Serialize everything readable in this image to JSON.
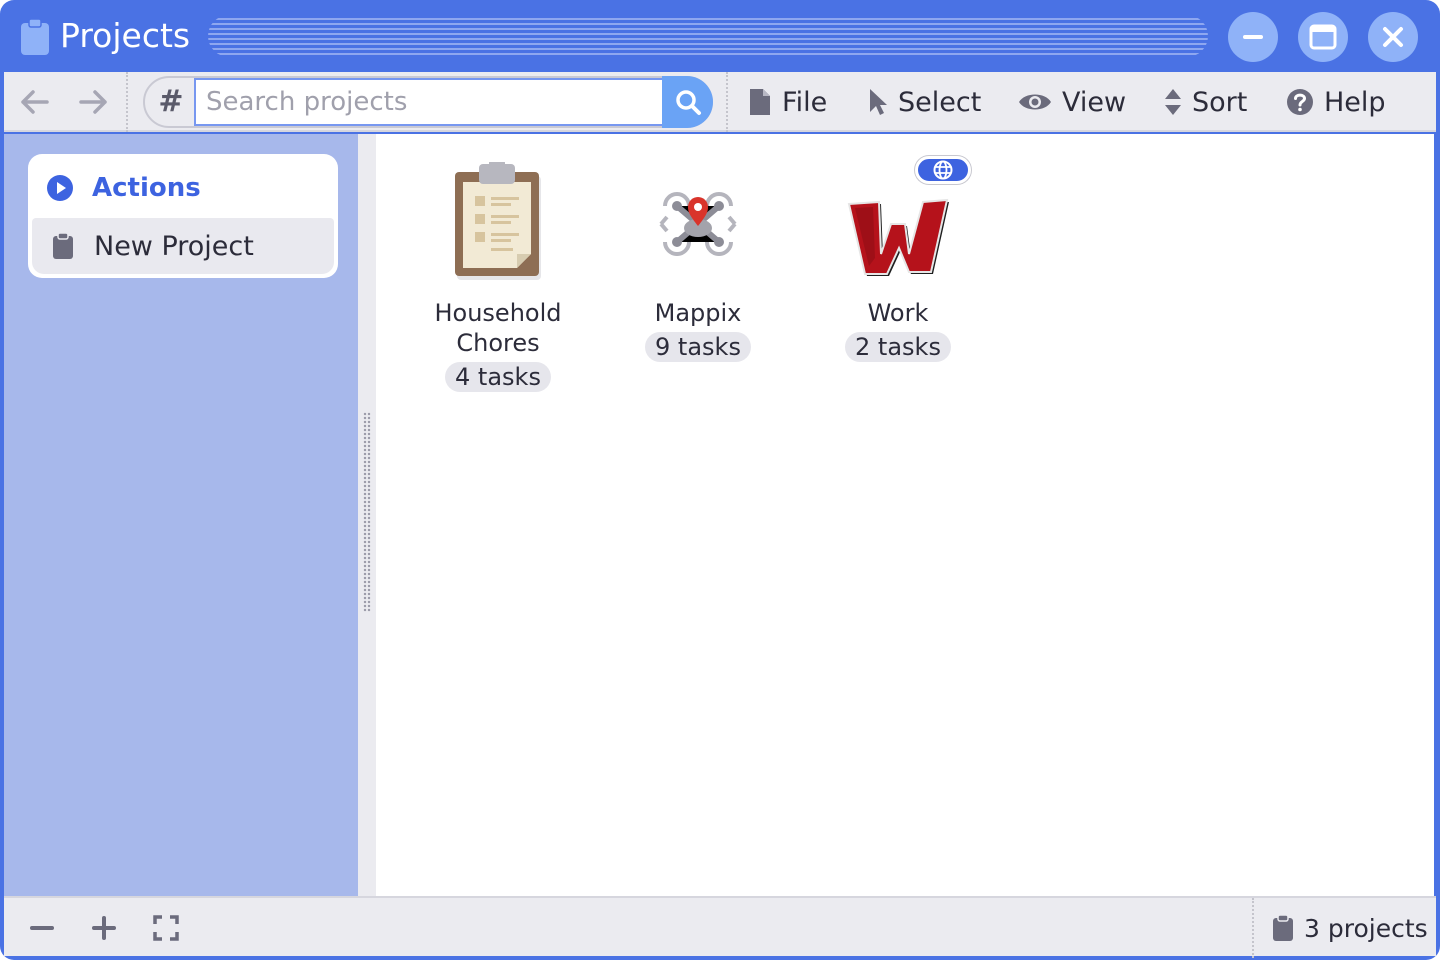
{
  "window": {
    "title": "Projects"
  },
  "titlebar": {
    "minimize_icon": "minimize-icon",
    "maximize_icon": "maximize-icon",
    "close_icon": "close-icon"
  },
  "toolbar": {
    "back_icon": "arrow-left-icon",
    "forward_icon": "arrow-right-icon",
    "search": {
      "prefix": "#",
      "placeholder": "Search projects",
      "value": ""
    },
    "menu": [
      {
        "label": "File",
        "icon": "file-icon"
      },
      {
        "label": "Select",
        "icon": "cursor-icon"
      },
      {
        "label": "View",
        "icon": "eye-icon"
      },
      {
        "label": "Sort",
        "icon": "sort-icon"
      },
      {
        "label": "Help",
        "icon": "help-icon"
      }
    ]
  },
  "sidebar": {
    "section_title": "Actions",
    "items": [
      {
        "label": "New Project",
        "icon": "clipboard-icon"
      }
    ]
  },
  "projects": [
    {
      "name": "Household Chores",
      "tasks": "4 tasks",
      "icon": "clipboard-icon"
    },
    {
      "name": "Mappix",
      "tasks": "9 tasks",
      "icon": "drone-icon"
    },
    {
      "name": "Work",
      "tasks": "2 tasks",
      "icon": "w-logo-icon",
      "badge_icon": "globe-icon"
    }
  ],
  "statusbar": {
    "zoom_out_icon": "minus-icon",
    "zoom_in_icon": "plus-icon",
    "fullscreen_icon": "fullscreen-icon",
    "count": "3 projects"
  },
  "colors": {
    "accent": "#4a72e4",
    "sidebar": "#a7b8eb",
    "link": "#3d63e0"
  }
}
